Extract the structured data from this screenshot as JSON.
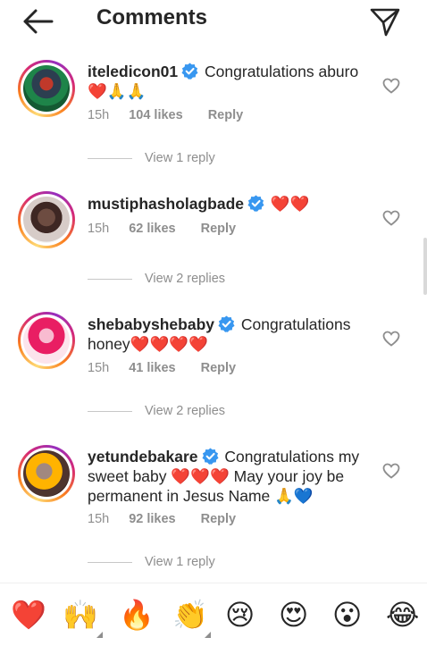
{
  "header": {
    "title": "Comments",
    "back_icon": "arrow-left-icon",
    "send_icon": "paper-plane-icon"
  },
  "comments": [
    {
      "username": "iteledicon01",
      "verified": true,
      "text_line1": "Congratulations aburo",
      "text_line2": "❤️🙏🙏",
      "time": "15h",
      "likes": "104 likes",
      "reply": "Reply",
      "view_replies": "View 1 reply"
    },
    {
      "username": "mustiphasholagbade",
      "verified": true,
      "text_line1": "❤️❤️",
      "time": "15h",
      "likes": "62 likes",
      "reply": "Reply",
      "view_replies": "View 2 replies"
    },
    {
      "username": "shebabyshebaby",
      "verified": true,
      "text_line1": "Congratulations",
      "text_line2": "honey❤️❤️❤️❤️",
      "time": "15h",
      "likes": "41 likes",
      "reply": "Reply",
      "view_replies": "View 2 replies"
    },
    {
      "username": "yetundebakare",
      "verified": true,
      "text_line1": "Congratulations my",
      "text_line2": "sweet baby ❤️❤️❤️ May your joy be",
      "text_line3": "permanent in Jesus Name 🙏💙",
      "time": "15h",
      "likes": "92 likes",
      "reply": "Reply",
      "view_replies": "View 1 reply"
    }
  ],
  "emoji_bar": [
    "❤️",
    "🙌",
    "🔥",
    "👏",
    "😢",
    "😍",
    "😮",
    "😂"
  ],
  "colors": {
    "verified": "#3897f0",
    "meta": "#8e8e8e",
    "text": "#262626"
  }
}
